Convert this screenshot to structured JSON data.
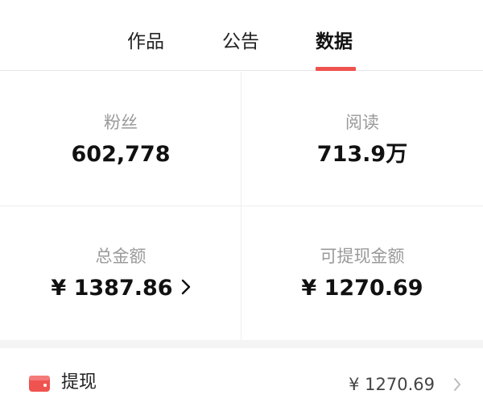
{
  "tabs": [
    {
      "label": "作品",
      "active": false
    },
    {
      "label": "公告",
      "active": false
    },
    {
      "label": "数据",
      "active": true
    }
  ],
  "stats": {
    "fans": {
      "label": "粉丝",
      "value": "602,778"
    },
    "reads": {
      "label": "阅读",
      "value": "713.9万"
    },
    "total": {
      "label": "总金额",
      "value": "¥ 1387.86"
    },
    "withdrawable": {
      "label": "可提现金额",
      "value": "¥ 1270.69"
    }
  },
  "withdraw": {
    "label": "提现",
    "amount": "¥ 1270.69",
    "icon": "wallet-icon"
  },
  "colors": {
    "accent": "#ef5350",
    "label_gray": "#9a9a9a",
    "divider": "#eeeeee"
  }
}
